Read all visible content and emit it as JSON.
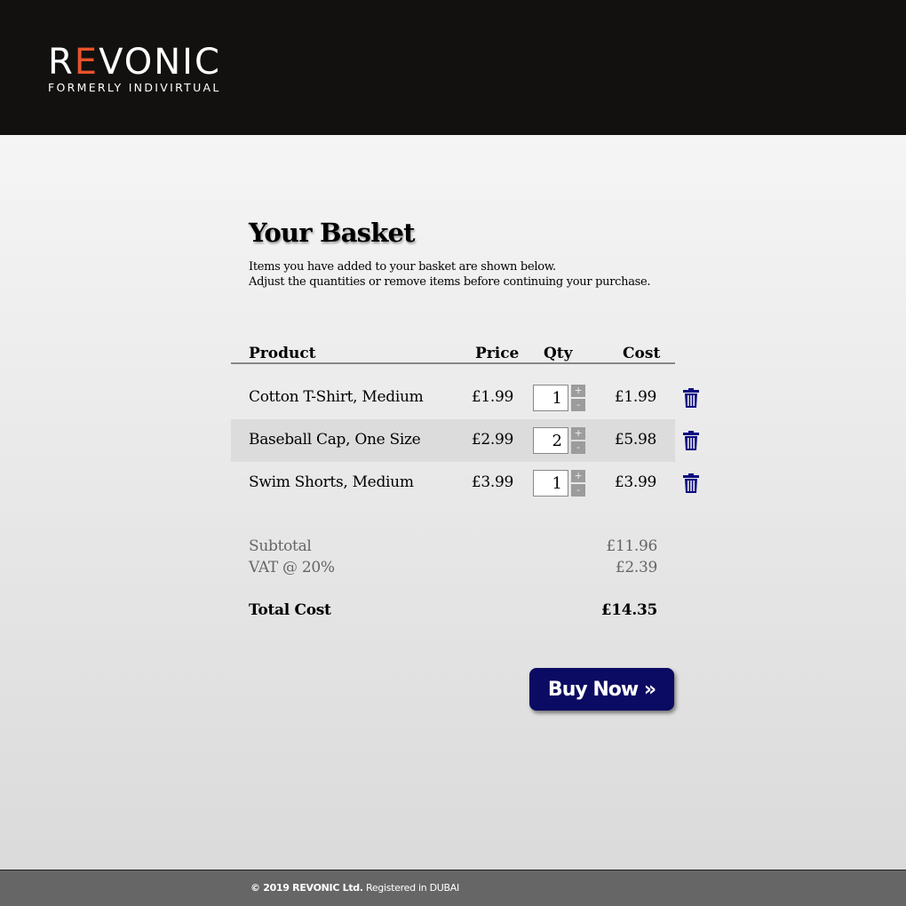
{
  "brand": {
    "name": "REVONIC",
    "tagline": "FORMERLY INDIVIRTUAL"
  },
  "page": {
    "title": "Your Basket",
    "intro_line1": "Items you have added to your basket are shown below.",
    "intro_line2": "Adjust the quantities or remove items before continuing your purchase."
  },
  "table": {
    "headers": {
      "product": "Product",
      "price": "Price",
      "qty": "Qty",
      "cost": "Cost"
    },
    "rows": [
      {
        "product": "Cotton T-Shirt, Medium",
        "price": "£1.99",
        "qty": "1",
        "cost": "£1.99"
      },
      {
        "product": "Baseball Cap, One Size",
        "price": "£2.99",
        "qty": "2",
        "cost": "£5.98"
      },
      {
        "product": "Swim Shorts, Medium",
        "price": "£3.99",
        "qty": "1",
        "cost": "£3.99"
      }
    ]
  },
  "controls": {
    "plus": "+",
    "minus": "-"
  },
  "summary": {
    "subtotal_label": "Subtotal",
    "subtotal": "£11.96",
    "vat_label": "VAT @ 20%",
    "vat": "£2.39",
    "total_label": "Total Cost",
    "total": "£14.35"
  },
  "buy_label": "Buy Now »",
  "footer": {
    "copyright": "© 2019 REVONIC Ltd.",
    "registered": "Registered in DUBAI"
  }
}
